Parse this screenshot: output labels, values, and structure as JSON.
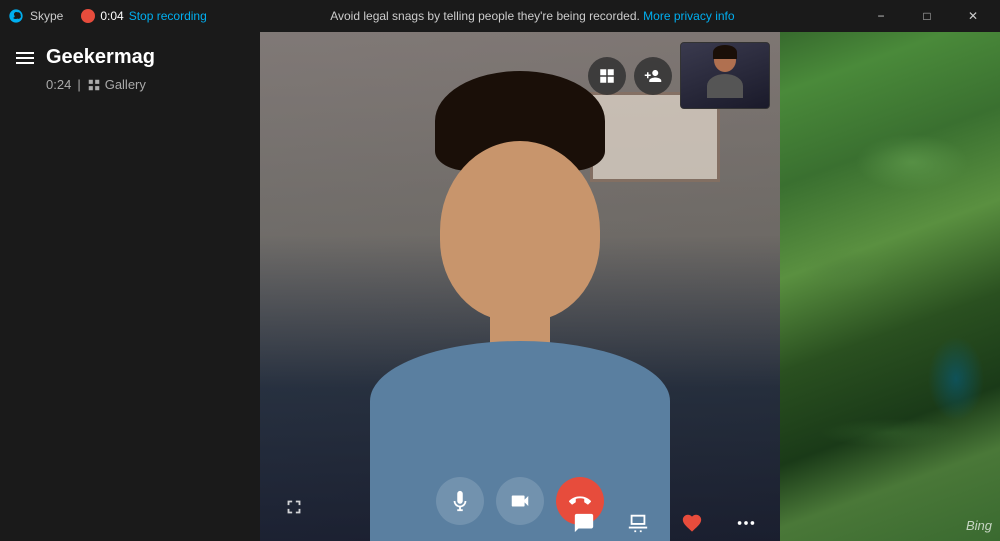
{
  "titlebar": {
    "app_name": "Skype",
    "rec_time": "0:04",
    "stop_recording_label": "Stop recording",
    "privacy_notice": "Avoid legal snags by telling people they're being recorded.",
    "privacy_link_label": "More privacy info",
    "btn_minimize": "−",
    "btn_maximize": "□",
    "btn_close": "✕"
  },
  "sidebar": {
    "contact_name": "Geekermag",
    "call_duration": "0:24",
    "gallery_label": "Gallery"
  },
  "controls": {
    "mute_label": "Mute",
    "video_label": "Video",
    "end_call_label": "End call",
    "chat_label": "Chat",
    "share_label": "Share",
    "react_label": "React",
    "more_label": "More",
    "fullscreen_label": "Fullscreen",
    "add_person_label": "Add person",
    "layout_label": "Layout"
  },
  "desktop": {
    "bing_label": "Bing"
  }
}
